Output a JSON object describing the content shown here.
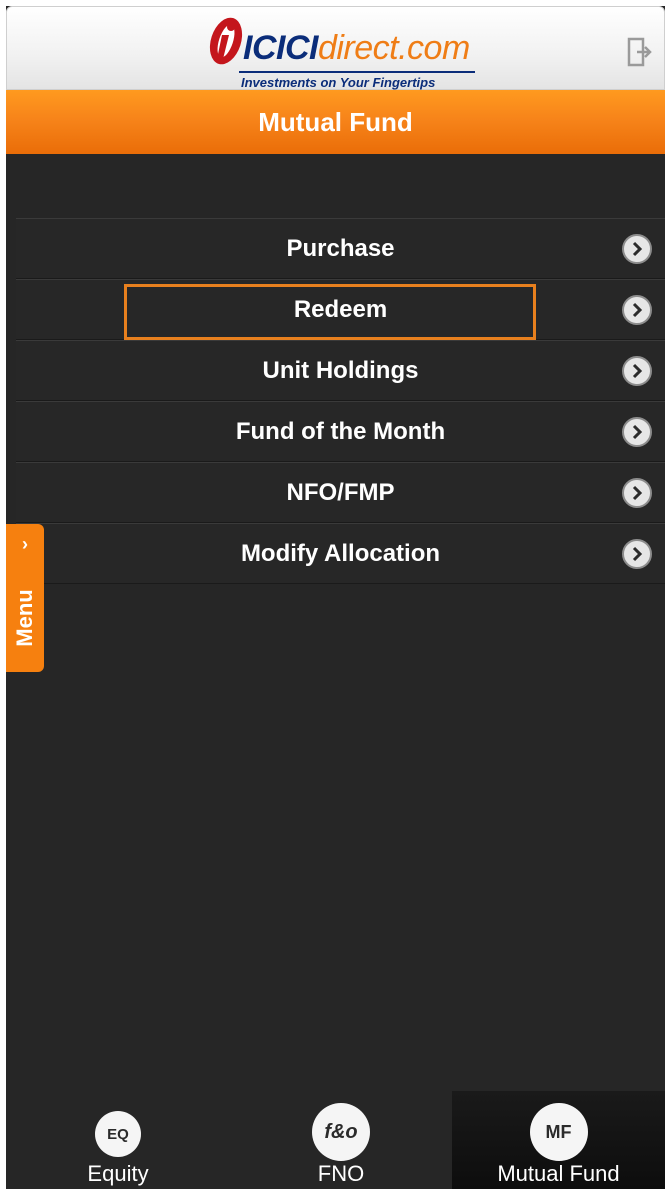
{
  "header": {
    "brand_main": "ICICI",
    "brand_sub": "direct.com",
    "tagline": "Investments on Your Fingertips",
    "logout_icon": "logout-icon"
  },
  "title": "Mutual Fund",
  "menu": {
    "items": [
      {
        "label": "Purchase"
      },
      {
        "label": "Redeem",
        "selected": true
      },
      {
        "label": "Unit Holdings"
      },
      {
        "label": "Fund of the Month"
      },
      {
        "label": "NFO/FMP"
      },
      {
        "label": "Modify Allocation"
      }
    ]
  },
  "side_menu": {
    "chevron": "›",
    "label": "Menu"
  },
  "tabs": [
    {
      "icon_text": "EQ",
      "label": "Equity"
    },
    {
      "icon_text": "f&o",
      "label": "FNO"
    },
    {
      "icon_text": "MF",
      "label": "Mutual Fund",
      "active": true
    }
  ],
  "colors": {
    "accent": "#f6800f",
    "highlight_border": "#e8801e",
    "background": "#262626",
    "brand_blue": "#0b2d7a"
  }
}
